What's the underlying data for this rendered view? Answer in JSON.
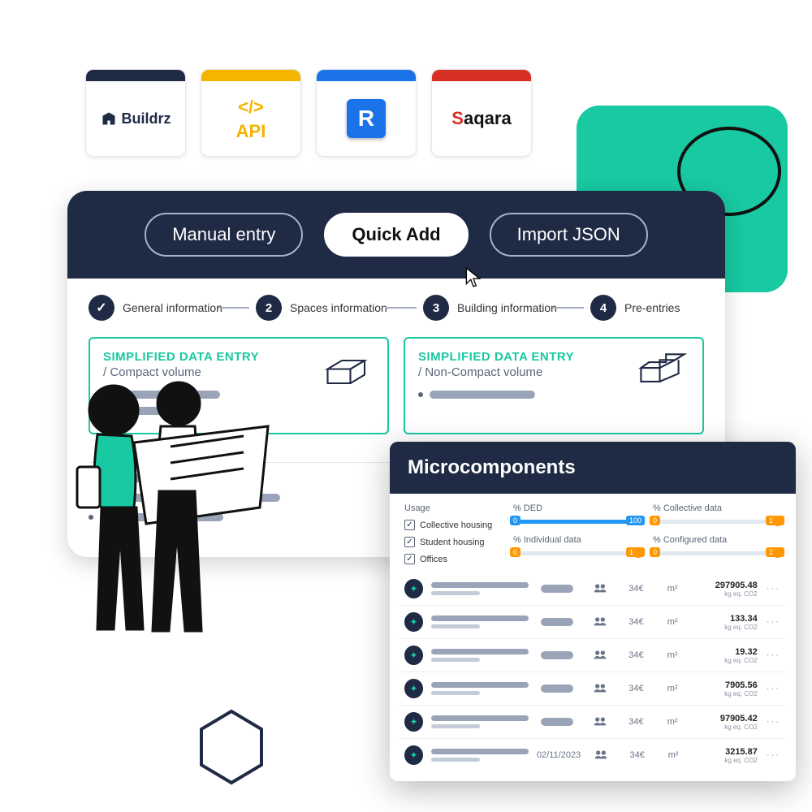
{
  "integrations": {
    "buildrz": "Buildrz",
    "api_line1": "</>",
    "api_line2": "API",
    "revit": "R",
    "saqara": "Saqara"
  },
  "tabs": {
    "manual": "Manual entry",
    "quick": "Quick Add",
    "import": "Import JSON"
  },
  "steps": [
    {
      "n": "✓",
      "label": "General information"
    },
    {
      "n": "2",
      "label": "Spaces information"
    },
    {
      "n": "3",
      "label": "Building information"
    },
    {
      "n": "4",
      "label": "Pre-entries"
    }
  ],
  "cards": {
    "heading": "SIMPLIFIED DATA ENTRY",
    "left_sub": "/ Compact volume",
    "right_sub": "/ Non-Compact volume"
  },
  "micro": {
    "title": "Microcomponents",
    "usage_label": "Usage",
    "usage": [
      "Collective housing",
      "Student housing",
      "Offices"
    ],
    "sliders": {
      "ded": "% DED",
      "indiv": "% Individual data",
      "coll": "% Collective data",
      "conf": "% Configured data",
      "min": "0",
      "max": "100"
    },
    "rows": [
      {
        "price": "34€",
        "unit": "m²",
        "val": "297905.48",
        "u": "kg eq. CO2"
      },
      {
        "price": "34€",
        "unit": "m²",
        "val": "133.34",
        "u": "kg eq. CO2"
      },
      {
        "price": "34€",
        "unit": "m²",
        "val": "19.32",
        "u": "kg eq. CO2"
      },
      {
        "price": "34€",
        "unit": "m²",
        "val": "7905.56",
        "u": "kg eq. CO2"
      },
      {
        "price": "34€",
        "unit": "m²",
        "val": "97905.42",
        "u": "kg eq. CO2"
      },
      {
        "date": "02/11/2023",
        "price": "34€",
        "unit": "m²",
        "val": "3215.87",
        "u": "kg eq. CO2"
      }
    ]
  }
}
